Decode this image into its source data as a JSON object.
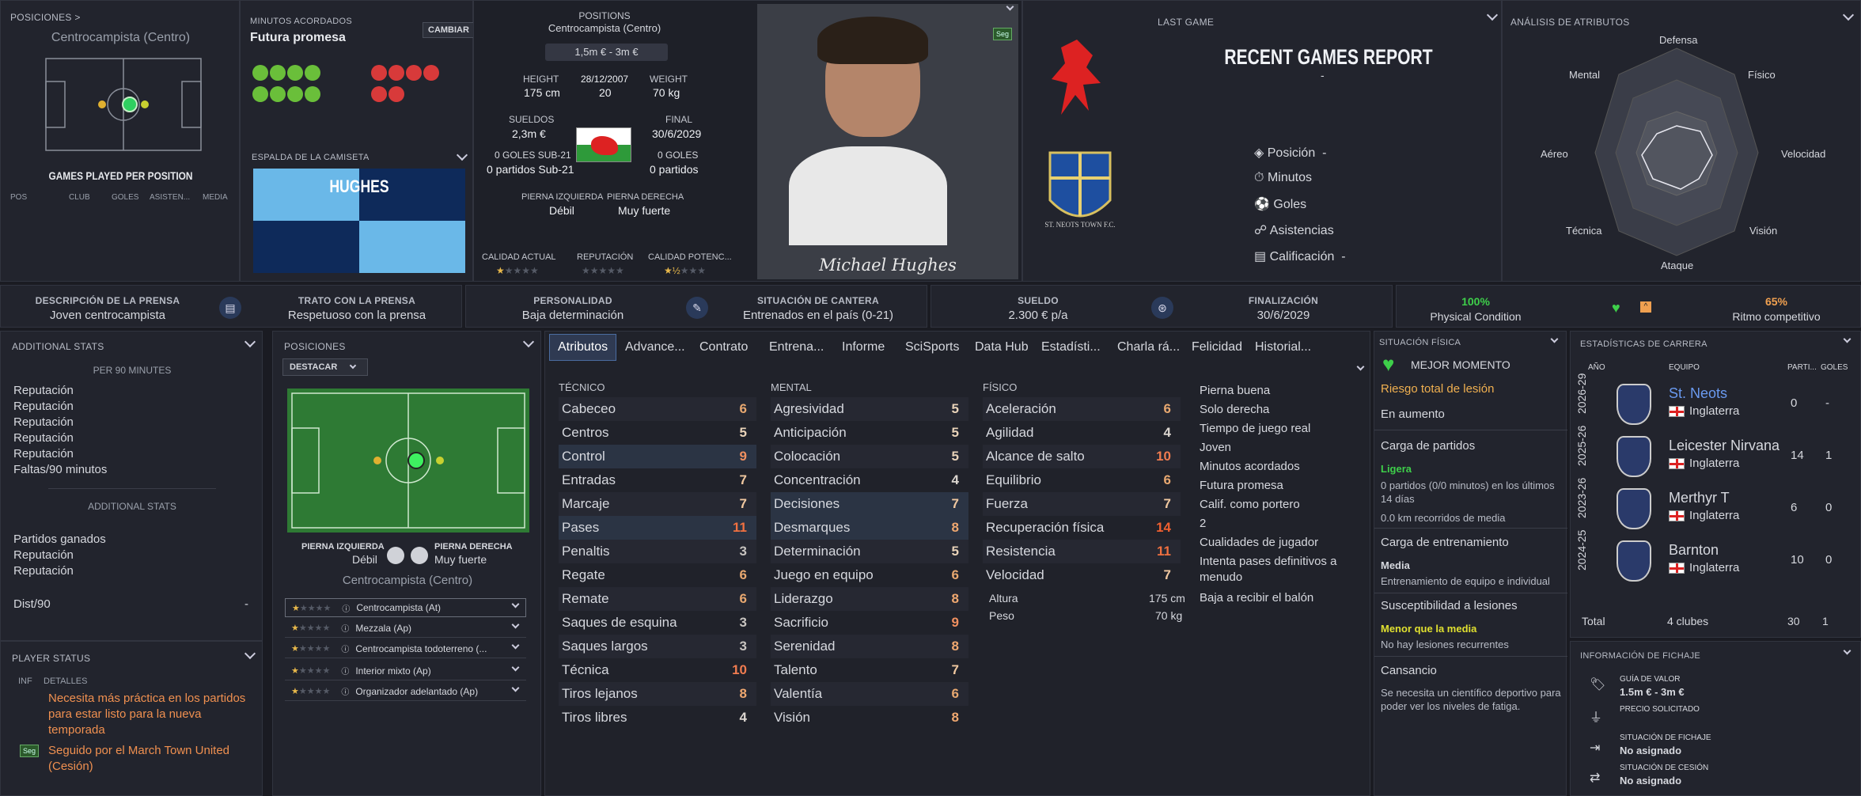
{
  "header": {
    "positions_title": "POSICIONES >",
    "main_position": "Centrocampista (Centro)",
    "games_played": "GAMES PLAYED PER POSITION",
    "gp_cols": [
      "POS",
      "CLUB",
      "GOLES",
      "ASISTEN...",
      "MEDIA"
    ],
    "minutes_label": "MINUTOS ACORDADOS",
    "minutes_value": "Futura promesa",
    "change_button": "CAMBIAR",
    "shirt_label": "ESPALDA DE LA CAMISETA",
    "shirt_name": "HUGHES",
    "positions_label": "POSITIONS",
    "positions_value": "Centrocampista (Centro)",
    "value_range": "1,5m € - 3m €",
    "height_label": "HEIGHT",
    "height": "175 cm",
    "dob": "28/12/2007",
    "age": "20",
    "weight_label": "WEIGHT",
    "weight": "70 kg",
    "wages_label": "SUELDOS",
    "wages": "2,3m €",
    "final_label": "FINAL",
    "final": "30/6/2029",
    "u21_goals": "0 GOLES SUB-21",
    "u21_games": "0 partidos Sub-21",
    "goals_label": "0 GOLES",
    "games": "0 partidos",
    "left_foot_label": "PIERNA IZQUIERDA",
    "left_foot": "Débil",
    "right_foot_label": "PIERNA DERECHA",
    "right_foot": "Muy fuerte",
    "current_ability": "CALIDAD ACTUAL",
    "reputation": "REPUTACIÓN",
    "potential": "CALIDAD POTENC...",
    "seg_badge": "Seg",
    "signature": "Michael Hughes",
    "last_game": "LAST GAME",
    "recent_report": "RECENT GAMES REPORT",
    "dash": "-",
    "report_rows": [
      {
        "label": "Posición",
        "val": "-"
      },
      {
        "label": "Minutos",
        "val": ""
      },
      {
        "label": "Goles",
        "val": ""
      },
      {
        "label": "Asistencias",
        "val": ""
      },
      {
        "label": "Calificación",
        "val": "-"
      }
    ],
    "club_crest_text": "ST. NEOTS TOWN F.C.",
    "attr_analysis": "ANÁLISIS DE ATRIBUTOS",
    "radar": [
      "Defensa",
      "Físico",
      "Velocidad",
      "Visión",
      "Ataque",
      "Técnica",
      "Aéreo",
      "Mental"
    ]
  },
  "bar": [
    {
      "title": "DESCRIPCIÓN DE LA PRENSA",
      "value": "Joven centrocampista"
    },
    {
      "title": "TRATO CON LA PRENSA",
      "value": "Respetuoso con la prensa"
    },
    {
      "title": "PERSONALIDAD",
      "value": "Baja determinación"
    },
    {
      "title": "SITUACIÓN DE CANTERA",
      "value": "Entrenados en el país (0-21)"
    },
    {
      "title": "SUELDO",
      "value": "2.300 € p/a"
    },
    {
      "title": "FINALIZACIÓN",
      "value": "30/6/2029"
    },
    {
      "title": "100%",
      "value": "Physical Condition"
    },
    {
      "title": "65%",
      "value": "Ritmo competitivo"
    }
  ],
  "additional": {
    "title": "ADDITIONAL STATS",
    "per90": "PER 90 MINUTES",
    "rows": [
      "Reputación",
      "Reputación",
      "Reputación",
      "Reputación",
      "Reputación",
      "Faltas/90 minutos"
    ],
    "sub": "ADDITIONAL STATS",
    "rows2": [
      "Partidos ganados",
      "Reputación",
      "Reputación"
    ],
    "dist": "Dist/90",
    "dist_val": "-"
  },
  "status": {
    "title": "PLAYER STATUS",
    "inf": "INF",
    "details": "DETALLES",
    "msg1": "Necesita más práctica en los partidos para estar listo para la nueva temporada",
    "seg": "Seg",
    "msg2": "Seguido por el March Town United (Cesión)"
  },
  "positions": {
    "title": "POSICIONES",
    "dropdown": "DESTACAR",
    "left_foot_label": "PIERNA IZQUIERDA",
    "left_foot": "Débil",
    "right_foot_label": "PIERNA DERECHA",
    "right_foot": "Muy fuerte",
    "position": "Centrocampista (Centro)",
    "roles": [
      "Centrocampista (At)",
      "Mezzala (Ap)",
      "Centrocampista todoterreno (...",
      "Interior mixto (Ap)",
      "Organizador adelantado (Ap)"
    ]
  },
  "tabs": [
    "Atributos",
    "Advance...",
    "Contrato",
    "Entrena...",
    "Informe",
    "SciSports",
    "Data Hub",
    "Estadísti...",
    "Charla rá...",
    "Felicidad",
    "Historial..."
  ],
  "attributes": {
    "tec_title": "TÉCNICO",
    "men_title": "MENTAL",
    "fis_title": "FÍSICO",
    "tecnico": [
      [
        "Cabeceo",
        "6"
      ],
      [
        "Centros",
        "5"
      ],
      [
        "Control",
        "9"
      ],
      [
        "Entradas",
        "7"
      ],
      [
        "Marcaje",
        "7"
      ],
      [
        "Pases",
        "11"
      ],
      [
        "Penaltis",
        "3"
      ],
      [
        "Regate",
        "6"
      ],
      [
        "Remate",
        "6"
      ],
      [
        "Saques de esquina",
        "3"
      ],
      [
        "Saques largos",
        "3"
      ],
      [
        "Técnica",
        "10"
      ],
      [
        "Tiros lejanos",
        "8"
      ],
      [
        "Tiros libres",
        "4"
      ]
    ],
    "mental": [
      [
        "Agresividad",
        "5"
      ],
      [
        "Anticipación",
        "5"
      ],
      [
        "Colocación",
        "5"
      ],
      [
        "Concentración",
        "4"
      ],
      [
        "Decisiones",
        "7"
      ],
      [
        "Desmarques",
        "8"
      ],
      [
        "Determinación",
        "5"
      ],
      [
        "Juego en equipo",
        "6"
      ],
      [
        "Liderazgo",
        "8"
      ],
      [
        "Sacrificio",
        "9"
      ],
      [
        "Serenidad",
        "8"
      ],
      [
        "Talento",
        "7"
      ],
      [
        "Valentía",
        "6"
      ],
      [
        "Visión",
        "8"
      ]
    ],
    "fisico": [
      [
        "Aceleración",
        "6"
      ],
      [
        "Agilidad",
        "4"
      ],
      [
        "Alcance de salto",
        "10"
      ],
      [
        "Equilibrio",
        "6"
      ],
      [
        "Fuerza",
        "7"
      ],
      [
        "Recuperación física",
        "14"
      ],
      [
        "Resistencia",
        "11"
      ],
      [
        "Velocidad",
        "7"
      ]
    ],
    "altura_label": "Altura",
    "altura": "175 cm",
    "peso_label": "Peso",
    "peso": "70 kg",
    "traits": [
      "Pierna buena",
      "Solo derecha",
      "Tiempo de juego real",
      "Joven",
      "Minutos acordados",
      "Futura promesa",
      "Calif. como portero",
      "2",
      "Cualidades de jugador",
      "Intenta pases definitivos a menudo",
      "Baja a recibir el balón"
    ]
  },
  "physical": {
    "title": "SITUACIÓN FÍSICA",
    "best": "MEJOR MOMENTO",
    "risk": "Riesgo total de lesión",
    "rising": "En aumento",
    "load": "Carga de partidos",
    "light": "Ligera",
    "load_text": "0 partidos (0/0 minutos) en los últimos 14 días",
    "km": "0.0 km recorridos de media",
    "train": "Carga de entrenamiento",
    "media": "Media",
    "train_text": "Entrenamiento de equipo e individual",
    "susc": "Susceptibilidad a lesiones",
    "less": "Menor que la media",
    "no_inj": "No hay lesiones recurrentes",
    "tired": "Cansancio",
    "tired_text": "Se necesita un científico deportivo para poder ver los niveles de fatiga."
  },
  "career": {
    "title": "ESTADÍSTICAS DE CARRERA",
    "cols": [
      "AÑO",
      "EQUIPO",
      "PARTI...",
      "GOLES"
    ],
    "rows": [
      {
        "year": "2026-29",
        "team": "St. Neots",
        "country": "Inglaterra",
        "apps": "0",
        "goals": "-"
      },
      {
        "year": "2025-26",
        "team": "Leicester Nirvana",
        "country": "Inglaterra",
        "apps": "14",
        "goals": "1"
      },
      {
        "year": "2023-26",
        "team": "Merthyr T",
        "country": "Inglaterra",
        "apps": "6",
        "goals": "0"
      },
      {
        "year": "2024-25",
        "team": "Barnton",
        "country": "Inglaterra",
        "apps": "10",
        "goals": "0"
      }
    ],
    "total": "Total",
    "total_clubs": "4 clubes",
    "total_apps": "30",
    "total_goals": "1"
  },
  "transfer": {
    "title": "INFORMACIÓN DE FICHAJE",
    "rows": [
      {
        "label": "GUÍA DE VALOR",
        "val": "1.5m € - 3m €"
      },
      {
        "label": "PRECIO SOLICITADO",
        "val": ""
      },
      {
        "label": "SITUACIÓN DE FICHAJE",
        "val": "No asignado"
      },
      {
        "label": "SITUACIÓN DE CESIÓN",
        "val": "No asignado"
      }
    ]
  },
  "colors": {
    "accent": "#4a6ca0",
    "green": "#3ecf4a",
    "orange": "#f0a050"
  }
}
